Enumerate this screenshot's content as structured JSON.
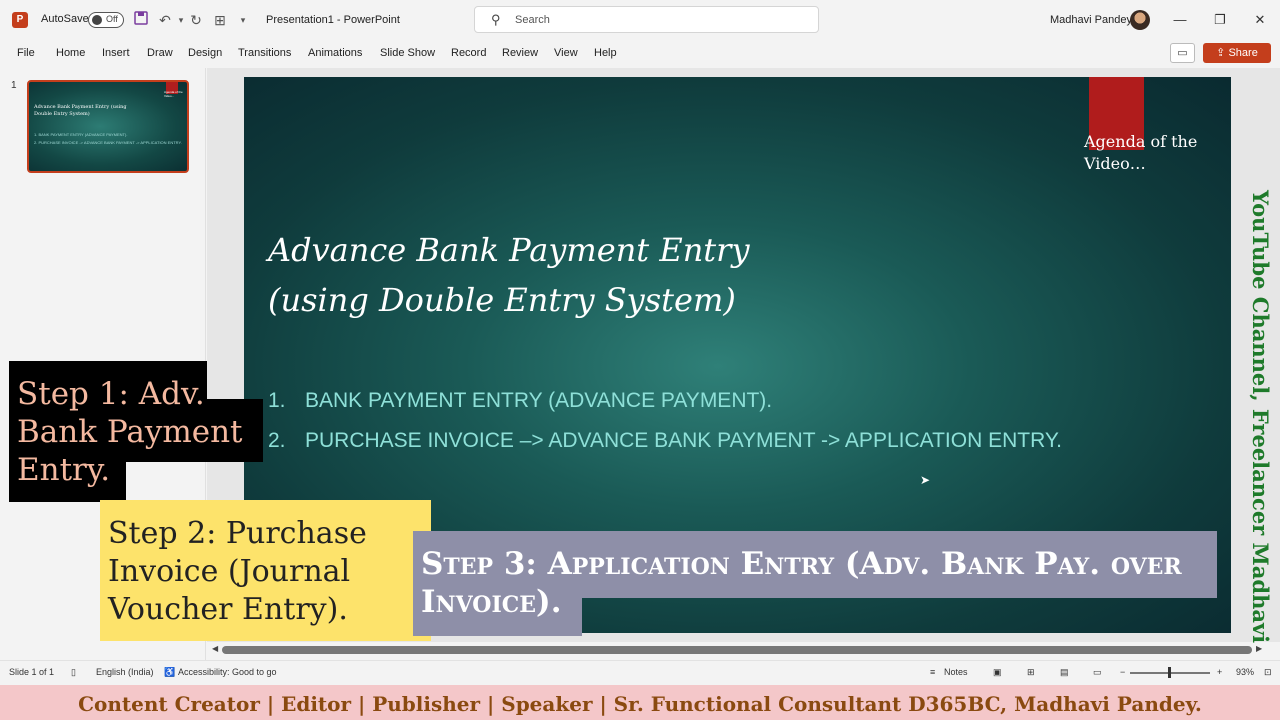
{
  "titlebar": {
    "app_logo": "P",
    "autosave_label": "AutoSave",
    "autosave_state": "Off",
    "doc_title": "Presentation1  -  PowerPoint",
    "search_placeholder": "Search",
    "user_name": "Madhavi Pandey",
    "window_buttons": [
      "—",
      "❐",
      "✕"
    ]
  },
  "ribbon": {
    "tabs": [
      "File",
      "Home",
      "Insert",
      "Draw",
      "Design",
      "Transitions",
      "Animations",
      "Slide Show",
      "Record",
      "Review",
      "View",
      "Help"
    ],
    "share_label": "Share"
  },
  "slide_pane": {
    "slide_number": "1",
    "thumb_title": "Advance Bank Payment Entry (using Double Entry System)",
    "thumb_items": [
      "1. BANK PAYMENT ENTRY (ADVANCE PAYMENT).",
      "2. PURCHASE INVOICE -> ADVANCE BANK PAYMENT -> APPLICATION ENTRY."
    ],
    "thumb_agenda": "Agenda of the Video..."
  },
  "slide": {
    "agenda": "Agenda of the Video…",
    "title_line1": "Advance Bank Payment Entry",
    "title_line2": "(using Double Entry System)",
    "items": [
      {
        "num": "1.",
        "text": "BANK PAYMENT ENTRY (ADVANCE PAYMENT)."
      },
      {
        "num": "2.",
        "text": "PURCHASE INVOICE –> ADVANCE BANK PAYMENT -> APPLICATION ENTRY."
      }
    ]
  },
  "overlays": {
    "step1": "Step 1: Adv. Bank Payment Entry.",
    "step2": "Step 2: Purchase Invoice (Journal Voucher Entry).",
    "step3": "Step 3: Application Entry (Adv. Bank Pay. over Invoice).",
    "vertical_text": "YouTube Channel, Freelancer Madhavi"
  },
  "statusbar": {
    "slide_info": "Slide 1 of 1",
    "language": "English (India)",
    "accessibility": "Accessibility: Good to go",
    "notes": "Notes",
    "zoom": "93%"
  },
  "footer": {
    "text": "Content Creator | Editor | Publisher | Speaker | Sr. Functional Consultant D365BC, Madhavi Pandey."
  },
  "colors": {
    "accent": "#c43e1c",
    "slide_bg": "#1a5a56",
    "step1_bg": "#000000",
    "step2_bg": "#fde36b",
    "step3_bg": "#8e8fa8",
    "footer_bg": "#f4c7c9"
  }
}
